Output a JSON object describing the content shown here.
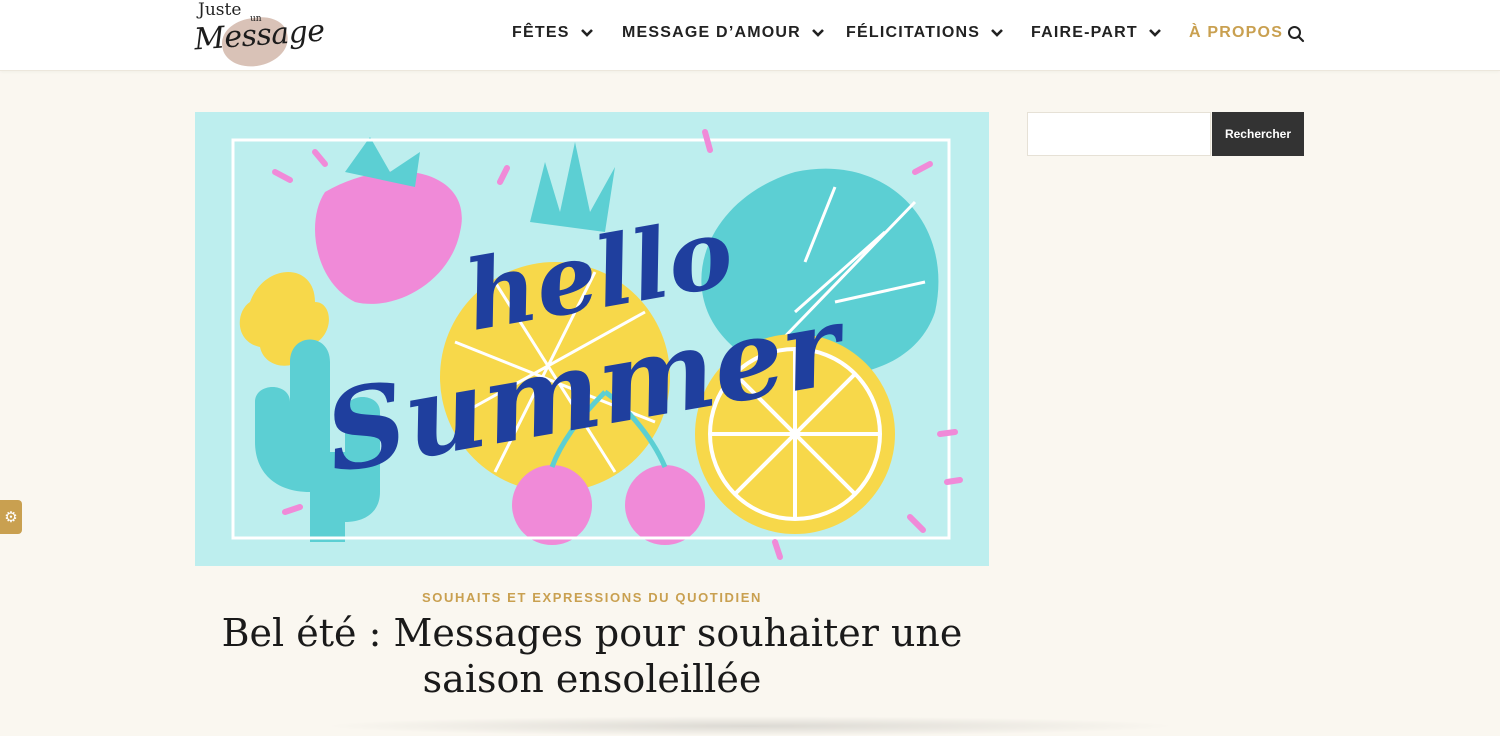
{
  "logo": {
    "line1": "Juste",
    "line2": "un",
    "line3": "Message"
  },
  "nav": {
    "items": [
      {
        "label": "FÊTES"
      },
      {
        "label": "MESSAGE D’AMOUR"
      },
      {
        "label": "FÉLICITATIONS"
      },
      {
        "label": "FAIRE-PART"
      },
      {
        "label": "À PROPOS"
      }
    ],
    "accent_color": "#c9a050"
  },
  "hero": {
    "lettering": [
      "hello",
      "Summer"
    ]
  },
  "post": {
    "category": "SOUHAITS ET EXPRESSIONS DU QUOTIDIEN",
    "title_line1": "Bel été : Messages pour souhaiter une",
    "title_line2": "saison ensoleillée"
  },
  "sidebar": {
    "search": {
      "button_label": "Rechercher",
      "value": ""
    }
  },
  "icons": {
    "search": "search-icon",
    "chevron": "chevron-down-icon",
    "settings": "gear-icon"
  }
}
